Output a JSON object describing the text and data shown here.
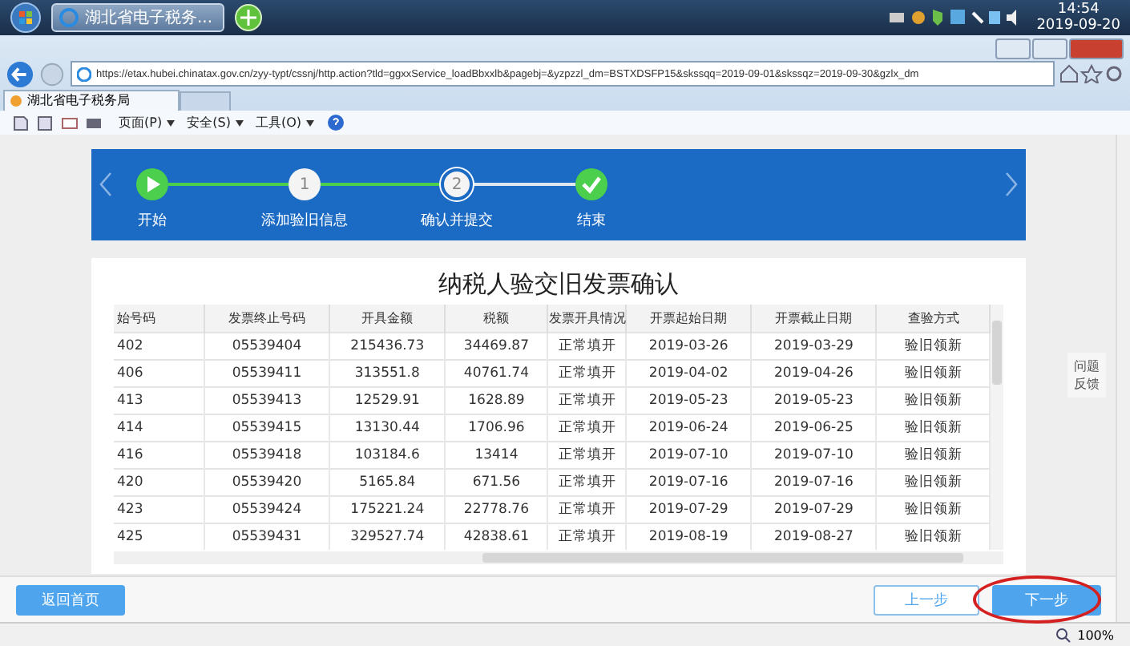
{
  "taskbar": {
    "tasks": [
      {
        "label": "湖北省电子税务...",
        "selected": true
      }
    ],
    "clock": {
      "time": "14:54",
      "date": "2019-09-20"
    }
  },
  "browser": {
    "address": "https://etax.hubei.chinatax.gov.cn/zyy-typt/cssnj/http.action?tld=ggxxService_loadBbxxlb&pagebj=&yzpzzl_dm=BSTXDSFP15&skssqq=2019-09-01&skssqz=2019-09-30&gzlx_dm",
    "tab": "湖北省电子税务局",
    "menus": [
      "页面(P)",
      "安全(S)",
      "工具(O)"
    ]
  },
  "steps": {
    "items": [
      {
        "kind": "start",
        "label": "开始",
        "selected": false
      },
      {
        "kind": "number",
        "number": "1",
        "label": "添加验旧信息",
        "selected": false
      },
      {
        "kind": "number",
        "number": "2",
        "label": "确认并提交",
        "selected": true
      },
      {
        "kind": "end",
        "label": "结束",
        "selected": false
      }
    ]
  },
  "title": "纳税人验交旧发票确认",
  "table": {
    "columns": [
      "始号码",
      "发票终止号码",
      "开具金额",
      "税额",
      "发票开具情况",
      "开票起始日期",
      "开票截止日期",
      "查验方式"
    ],
    "rows": [
      [
        "402",
        "05539404",
        "215436.73",
        "34469.87",
        "正常填开",
        "2019-03-26",
        "2019-03-29",
        "验旧领新"
      ],
      [
        "406",
        "05539411",
        "313551.8",
        "40761.74",
        "正常填开",
        "2019-04-02",
        "2019-04-26",
        "验旧领新"
      ],
      [
        "413",
        "05539413",
        "12529.91",
        "1628.89",
        "正常填开",
        "2019-05-23",
        "2019-05-23",
        "验旧领新"
      ],
      [
        "414",
        "05539415",
        "13130.44",
        "1706.96",
        "正常填开",
        "2019-06-24",
        "2019-06-25",
        "验旧领新"
      ],
      [
        "416",
        "05539418",
        "103184.6",
        "13414",
        "正常填开",
        "2019-07-10",
        "2019-07-10",
        "验旧领新"
      ],
      [
        "420",
        "05539420",
        "5165.84",
        "671.56",
        "正常填开",
        "2019-07-16",
        "2019-07-16",
        "验旧领新"
      ],
      [
        "423",
        "05539424",
        "175221.24",
        "22778.76",
        "正常填开",
        "2019-07-29",
        "2019-07-29",
        "验旧领新"
      ],
      [
        "425",
        "05539431",
        "329527.74",
        "42838.61",
        "正常填开",
        "2019-08-19",
        "2019-08-27",
        "验旧领新"
      ]
    ]
  },
  "feedback": [
    "问题",
    "反馈"
  ],
  "buttons": {
    "home": "返回首页",
    "prev": "上一步",
    "next": "下一步",
    "next_highlighted": true
  },
  "zoom": "100%"
}
